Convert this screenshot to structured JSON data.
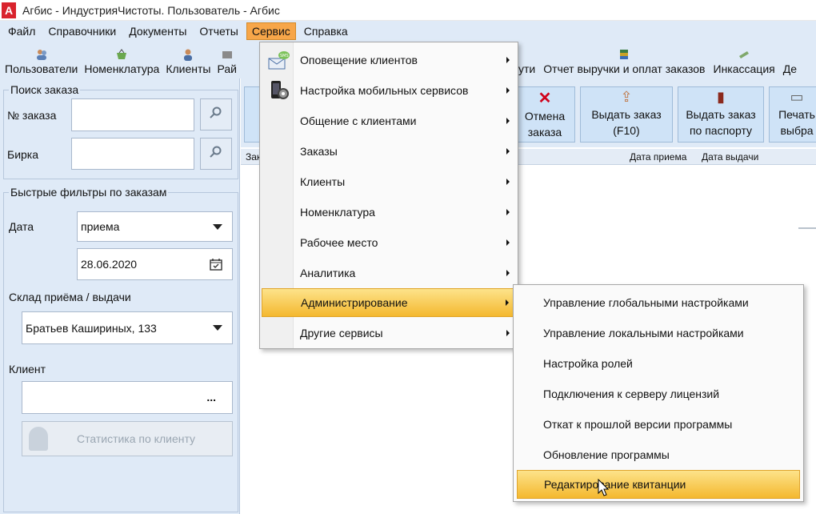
{
  "window": {
    "title": "Агбис - ИндустрияЧистоты. Пользователь - Агбис",
    "logo": "A"
  },
  "menubar": [
    "Файл",
    "Справочники",
    "Документы",
    "Отчеты",
    "Сервис",
    "Справка"
  ],
  "toolbar": {
    "left": [
      {
        "label": "Пользователи",
        "icon": "users-icon"
      },
      {
        "label": "Номенклатура",
        "icon": "basket-icon"
      },
      {
        "label": "Клиенты",
        "icon": "client-icon"
      },
      {
        "label": "Рай",
        "icon": "route-icon"
      }
    ],
    "right_fragment": "ути",
    "right": [
      {
        "label": "Отчет выручки и оплат заказов",
        "icon": "report-icon"
      },
      {
        "label": "Инкассация",
        "icon": "money-icon"
      },
      {
        "label": "Де",
        "icon": "more-icon"
      }
    ]
  },
  "left_panel": {
    "order_search": {
      "title": "Поиск заказа",
      "order_no_label": "№ заказа",
      "order_no_value": "",
      "tag_label": "Бирка",
      "tag_value": ""
    },
    "quick_filters": {
      "title": "Быстрые фильтры по заказам",
      "date_label": "Дата",
      "date_type": "приема",
      "date_value": "28.06.2020",
      "warehouse_label": "Склад приёма / выдачи",
      "warehouse_value": "Братьев Кашириных, 133",
      "client_label": "Клиент",
      "client_value": "",
      "client_more": "...",
      "stats_button": "Статистика по клиенту"
    }
  },
  "main": {
    "buttons": [
      {
        "label1": "Отмена",
        "label2": "заказа",
        "icon": "✕"
      },
      {
        "label1": "Выдать заказ",
        "label2": "(F10)",
        "icon": "⇪"
      },
      {
        "label1": "Выдать заказ",
        "label2": "по паспорту",
        "icon": "▮"
      },
      {
        "label1": "Печать",
        "label2": "выбра",
        "icon": "▭"
      }
    ],
    "columns": [
      "Зак",
      "Дата приема",
      "Дата выдачи"
    ]
  },
  "service_menu": [
    {
      "label": "Оповещение клиентов",
      "icon": "sms-mail-icon"
    },
    {
      "label": "Настройка мобильных сервисов",
      "icon": "phone-gear-icon"
    },
    {
      "label": "Общение с клиентами"
    },
    {
      "label": "Заказы"
    },
    {
      "label": "Клиенты"
    },
    {
      "label": "Номенклатура"
    },
    {
      "label": "Рабочее место"
    },
    {
      "label": "Аналитика"
    },
    {
      "label": "Администрирование",
      "highlighted": true
    },
    {
      "label": "Другие сервисы"
    }
  ],
  "admin_submenu": [
    {
      "label": "Управление глобальными настройками"
    },
    {
      "label": "Управление локальными настройками"
    },
    {
      "label": "Настройка ролей"
    },
    {
      "label": "Подключения к серверу лицензий"
    },
    {
      "label": "Откат к прошлой версии программы"
    },
    {
      "label": "Обновление программы"
    },
    {
      "label": "Редактирование квитанции",
      "highlighted": true
    }
  ]
}
